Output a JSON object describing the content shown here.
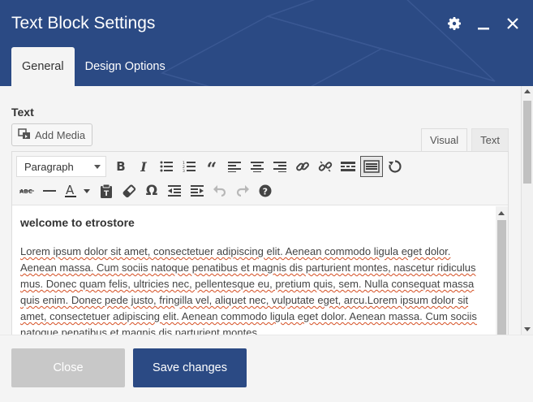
{
  "header": {
    "title": "Text Block Settings",
    "icons": [
      "gear-icon",
      "minimize-icon",
      "close-icon"
    ],
    "color": "#2b4a84"
  },
  "tabs": [
    {
      "label": "General",
      "active": true
    },
    {
      "label": "Design Options",
      "active": false
    }
  ],
  "field": {
    "label": "Text",
    "add_media_label": "Add Media"
  },
  "editor_tabs": [
    {
      "label": "Visual",
      "active": true
    },
    {
      "label": "Text",
      "active": false
    }
  ],
  "toolbar": {
    "format_value": "Paragraph",
    "row1": [
      "bold-icon",
      "italic-icon",
      "bulleted-list-icon",
      "numbered-list-icon",
      "blockquote-icon",
      "align-left-icon",
      "align-center-icon",
      "align-right-icon",
      "link-icon",
      "unlink-icon",
      "read-more-icon",
      "toolbar-toggle-icon",
      "refresh-icon"
    ],
    "row2": [
      "strikethrough-icon",
      "horizontal-line-icon",
      "text-color-icon",
      "paste-as-text-icon",
      "clear-formatting-icon",
      "special-character-icon",
      "decrease-indent-icon",
      "increase-indent-icon",
      "undo-icon",
      "redo-icon",
      "help-icon"
    ]
  },
  "content": {
    "heading": "welcome to etrostore",
    "paragraph": "Lorem ipsum dolor sit amet, consectetuer adipiscing elit. Aenean commodo ligula eget dolor. Aenean massa. Cum sociis natoque penatibus et magnis dis parturient montes, nascetur ridiculus mus. Donec quam felis, ultricies nec, pellentesque eu, pretium quis, sem. Nulla consequat massa quis enim. Donec pede justo, fringilla vel, aliquet nec, vulputate eget, arcu.Lorem ipsum dolor sit amet, consectetuer adipiscing elit. Aenean commodo ligula eget dolor. Aenean massa. Cum sociis natoque penatibus et magnis dis parturient montes,"
  },
  "footer": {
    "close_label": "Close",
    "save_label": "Save changes"
  }
}
